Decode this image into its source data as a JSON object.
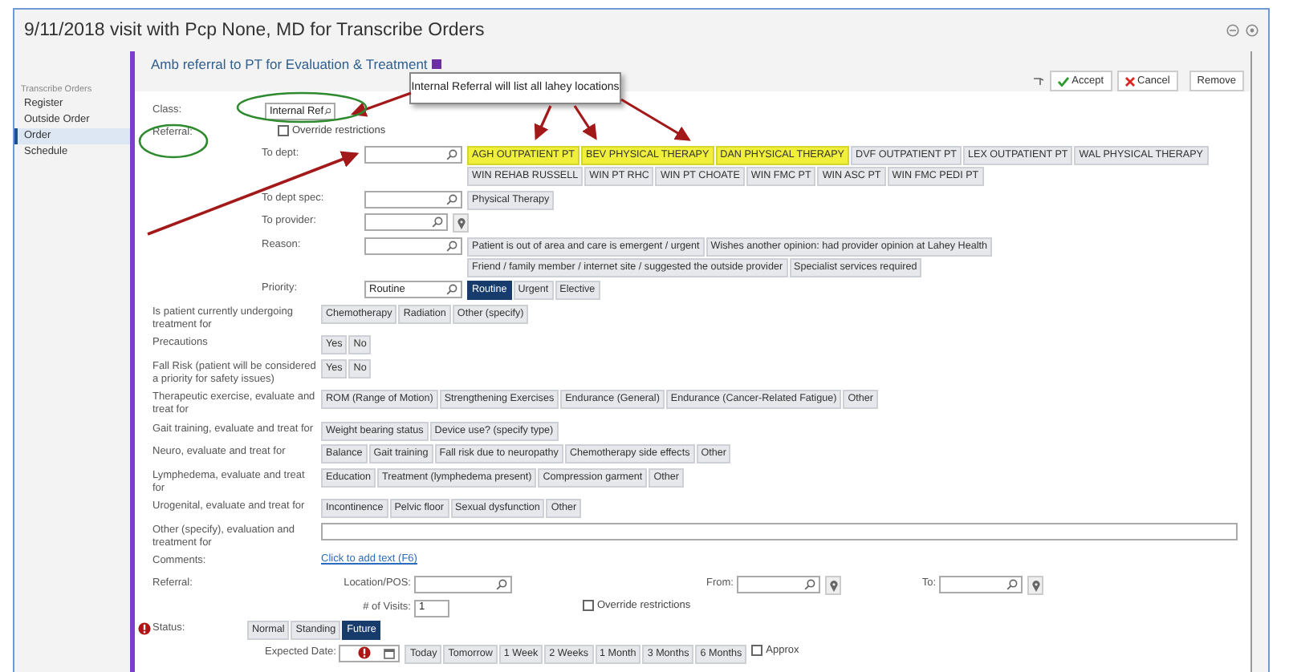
{
  "window": {
    "title": "9/11/2018 visit with Pcp None, MD for Transcribe Orders"
  },
  "sidebar": {
    "heading": "Transcribe Orders",
    "items": [
      {
        "label": "Register",
        "selected": false
      },
      {
        "label": "Outside Order",
        "selected": false
      },
      {
        "label": "Order",
        "selected": true
      },
      {
        "label": "Schedule",
        "selected": false
      }
    ]
  },
  "order": {
    "title": "Amb referral to PT for Evaluation & Treatment",
    "actions": [
      {
        "kind": "accept",
        "label": "Accept"
      },
      {
        "kind": "cancel",
        "label": "Cancel"
      },
      {
        "kind": "remove",
        "label": "Remove"
      }
    ]
  },
  "callout": {
    "text": "Internal Referral will list all lahey locations"
  },
  "rows": [
    {
      "kind": "head",
      "label": "Class:",
      "field": {
        "value": "Internal Ref",
        "locate": false
      }
    },
    {
      "kind": "head",
      "label": "Referral:",
      "checkbox": {
        "label": "Override restrictions",
        "checked": false
      }
    },
    {
      "kind": "sub",
      "label": "To dept:",
      "field": {
        "locate": false
      },
      "options": [
        {
          "label": "AGH OUTPATIENT PT",
          "selected": false,
          "highlighted": true
        },
        {
          "label": "BEV PHYSICAL THERAPY",
          "selected": false,
          "highlighted": true
        },
        {
          "label": "DAN PHYSICAL THERAPY",
          "selected": false,
          "highlighted": true
        },
        {
          "label": "DVF OUTPATIENT PT",
          "selected": false,
          "highlighted": false
        },
        {
          "label": "LEX OUTPATIENT PT",
          "selected": false,
          "highlighted": false
        },
        {
          "label": "WAL PHYSICAL THERAPY",
          "selected": false,
          "highlighted": false
        },
        {
          "label": "WIN REHAB RUSSELL",
          "selected": false,
          "highlighted": false
        },
        {
          "label": "WIN PT RHC",
          "selected": false,
          "highlighted": false
        },
        {
          "label": "WIN PT CHOATE",
          "selected": false,
          "highlighted": false
        },
        {
          "label": "WIN FMC PT",
          "selected": false,
          "highlighted": false
        },
        {
          "label": "WIN ASC PT",
          "selected": false,
          "highlighted": false
        },
        {
          "label": "WIN FMC PEDI PT",
          "selected": false,
          "highlighted": false
        }
      ]
    },
    {
      "kind": "sub",
      "label": "To dept spec:",
      "field": {
        "locate": false
      },
      "options": [
        {
          "label": "Physical Therapy",
          "selected": false
        }
      ]
    },
    {
      "kind": "sub",
      "label": "To provider:",
      "field": {
        "locate": true
      }
    },
    {
      "kind": "sub",
      "label": "Reason:",
      "field": {
        "locate": false
      },
      "options": [
        {
          "label": "Patient is out of area and care is emergent / urgent",
          "selected": false
        },
        {
          "label": "Wishes another opinion: had provider opinion at Lahey Health",
          "selected": false
        },
        {
          "label": "Friend / family member / internet site / suggested the outside provider",
          "selected": false
        },
        {
          "label": "Specialist services required",
          "selected": false
        }
      ]
    },
    {
      "kind": "sub",
      "label": "Priority:",
      "field": {
        "value": "Routine",
        "locate": false
      },
      "options": [
        {
          "label": "Routine",
          "selected": true
        },
        {
          "label": "Urgent",
          "selected": false
        },
        {
          "label": "Elective",
          "selected": false
        }
      ]
    },
    {
      "kind": "question",
      "label": "Is patient currently undergoing treatment for",
      "options": [
        {
          "label": "Chemotherapy",
          "selected": false
        },
        {
          "label": "Radiation",
          "selected": false
        },
        {
          "label": "Other (specify)",
          "selected": false
        }
      ]
    },
    {
      "kind": "question",
      "label": "Precautions",
      "options": [
        {
          "label": "Yes",
          "selected": false
        },
        {
          "label": "No",
          "selected": false
        }
      ]
    },
    {
      "kind": "question",
      "label": "Fall Risk (patient will be considered a priority for safety issues)",
      "options": [
        {
          "label": "Yes",
          "selected": false
        },
        {
          "label": "No",
          "selected": false
        }
      ]
    },
    {
      "kind": "question",
      "label": "Therapeutic exercise, evaluate and treat for",
      "options": [
        {
          "label": "ROM (Range of Motion)",
          "selected": false
        },
        {
          "label": "Strengthening Exercises",
          "selected": false
        },
        {
          "label": "Endurance (General)",
          "selected": false
        },
        {
          "label": "Endurance (Cancer-Related Fatigue)",
          "selected": false
        },
        {
          "label": "Other",
          "selected": false
        }
      ]
    },
    {
      "kind": "question",
      "label": "Gait training, evaluate and treat for",
      "options": [
        {
          "label": "Weight bearing status",
          "selected": false
        },
        {
          "label": "Device use? (specify type)",
          "selected": false
        }
      ]
    },
    {
      "kind": "question",
      "label": "Neuro, evaluate and treat for",
      "options": [
        {
          "label": "Balance",
          "selected": false
        },
        {
          "label": "Gait training",
          "selected": false
        },
        {
          "label": "Fall risk due to neuropathy",
          "selected": false
        },
        {
          "label": "Chemotherapy side effects",
          "selected": false
        },
        {
          "label": "Other",
          "selected": false
        }
      ]
    },
    {
      "kind": "question",
      "label": "Lymphedema, evaluate and treat for",
      "options": [
        {
          "label": "Education",
          "selected": false
        },
        {
          "label": "Treatment (lymphedema present)",
          "selected": false
        },
        {
          "label": "Compression garment",
          "selected": false
        },
        {
          "label": "Other",
          "selected": false
        }
      ]
    },
    {
      "kind": "question",
      "label": "Urogenital, evaluate and treat for",
      "options": [
        {
          "label": "Incontinence",
          "selected": false
        },
        {
          "label": "Pelvic floor",
          "selected": false
        },
        {
          "label": "Sexual dysfunction",
          "selected": false
        },
        {
          "label": "Other",
          "selected": false
        }
      ]
    },
    {
      "kind": "text_question",
      "label": "Other (specify), evaluation and treatment for"
    },
    {
      "kind": "link",
      "label": "Comments:",
      "link": "Click to add text (F6)"
    },
    {
      "kind": "referral",
      "label": "Referral:",
      "location": "Location/POS:",
      "from": "From:",
      "to": "To:",
      "visits": {
        "label": "# of Visits:",
        "value": "1"
      },
      "checkbox": {
        "label": "Override restrictions",
        "checked": false
      }
    },
    {
      "kind": "status",
      "label": "Status:",
      "required": true,
      "options": [
        {
          "label": "Normal",
          "selected": false
        },
        {
          "label": "Standing",
          "selected": false
        },
        {
          "label": "Future",
          "selected": true
        }
      ]
    },
    {
      "kind": "date",
      "label": "Expected Date:",
      "required": true,
      "options": [
        {
          "label": "Today",
          "selected": false
        },
        {
          "label": "Tomorrow",
          "selected": false
        },
        {
          "label": "1 Week",
          "selected": false
        },
        {
          "label": "2 Weeks",
          "selected": false
        },
        {
          "label": "1 Month",
          "selected": false
        },
        {
          "label": "3 Months",
          "selected": false
        },
        {
          "label": "6 Months",
          "selected": false
        }
      ],
      "checkbox": {
        "label": "Approx",
        "checked": false
      }
    }
  ]
}
